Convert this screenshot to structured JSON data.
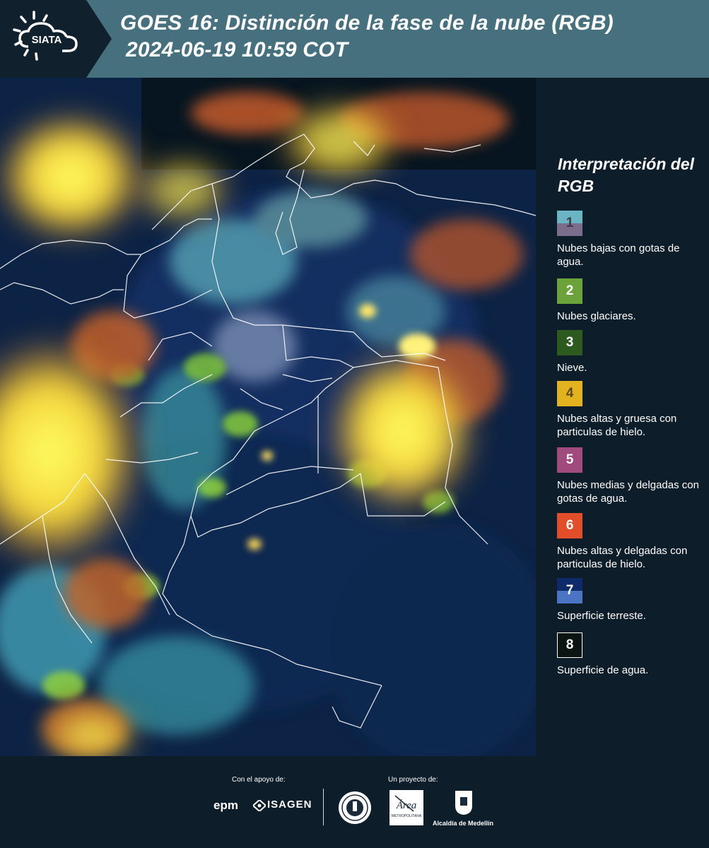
{
  "header": {
    "logo_text": "SIATA",
    "title_line1": "GOES 16: Distinción de la fase de la nube (RGB)",
    "title_line2": "2024-06-19 10:59 COT",
    "background": "#47707f"
  },
  "legend": {
    "title": "Interpretación del RGB",
    "items": [
      {
        "number": "1",
        "text": "Nubes bajas con gotas de agua.",
        "colors": [
          "#6ab4c4",
          "#7a6e8c"
        ]
      },
      {
        "number": "2",
        "text": "Nubes glaciares.",
        "colors": [
          "#6ba33a"
        ]
      },
      {
        "number": "3",
        "text": "Nieve.",
        "colors": [
          "#2d5a1e"
        ]
      },
      {
        "number": "4",
        "text": "Nubes altas y gruesa con particulas de hielo.",
        "colors": [
          "#e2b21f"
        ]
      },
      {
        "number": "5",
        "text": "Nubes medias y delgadas con gotas de agua.",
        "colors": [
          "#a04a7e"
        ]
      },
      {
        "number": "6",
        "text": "Nubes altas y delgadas con particulas de hielo.",
        "colors": [
          "#e34e2a"
        ]
      },
      {
        "number": "7",
        "text": "Superficie terreste.",
        "colors": [
          "#0f2a6b",
          "#4b74c4"
        ]
      },
      {
        "number": "8",
        "text": "Superficie de agua.",
        "colors": [
          "#0a1410"
        ]
      }
    ]
  },
  "footer": {
    "support_label": "Con el apoyo de:",
    "project_label": "Un proyecto de:",
    "sponsor1": "epm",
    "sponsor2": "ISAGEN",
    "partner_metro": "METROPOLITANA",
    "partner_medellin": "Alcaldía de Medellín"
  }
}
